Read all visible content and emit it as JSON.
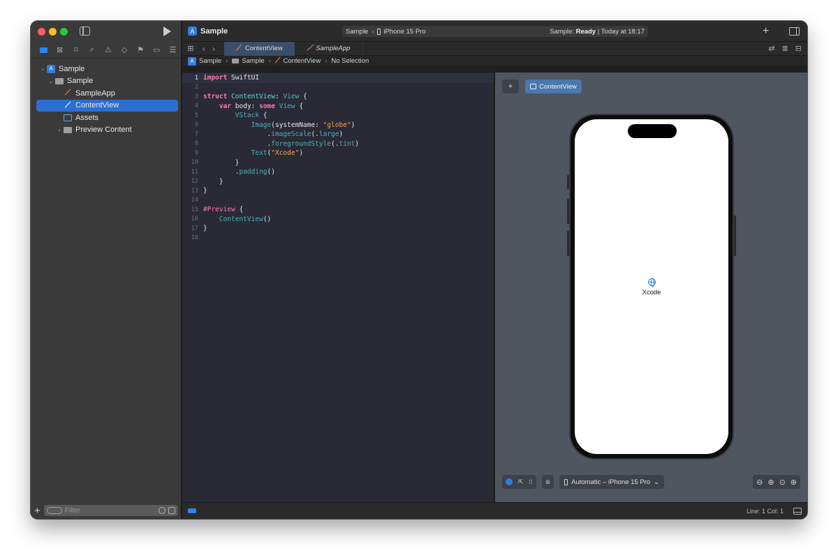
{
  "window": {
    "title": "Sample"
  },
  "toolbar": {
    "scheme_target": "Sample",
    "scheme_device": "iPhone 15 Pro",
    "status_prefix": "Sample:",
    "status_state": "Ready",
    "status_time": "| Today at 18:17"
  },
  "navigator": {
    "tree": [
      {
        "label": "Sample",
        "kind": "project",
        "depth": 0,
        "expanded": true
      },
      {
        "label": "Sample",
        "kind": "folder",
        "depth": 1,
        "expanded": true
      },
      {
        "label": "SampleApp",
        "kind": "swift",
        "depth": 2
      },
      {
        "label": "ContentView",
        "kind": "swift",
        "depth": 2,
        "selected": true
      },
      {
        "label": "Assets",
        "kind": "assets",
        "depth": 2
      },
      {
        "label": "Preview Content",
        "kind": "folder",
        "depth": 2,
        "expanded": false
      }
    ],
    "filter_placeholder": "Filter"
  },
  "tabs": [
    {
      "label": "ContentView",
      "active": true
    },
    {
      "label": "SampleApp",
      "active": false
    }
  ],
  "jumpbar": {
    "project": "Sample",
    "group": "Sample",
    "file": "ContentView",
    "symbol": "No Selection"
  },
  "editor": {
    "lines": [
      {
        "n": "1",
        "html": "<span class=\"kw\">import</span> SwiftUI"
      },
      {
        "n": "2",
        "html": ""
      },
      {
        "n": "3",
        "html": "<span class=\"kw\">struct</span> <span class=\"fn\">ContentView</span>: <span class=\"ty\">View</span> {"
      },
      {
        "n": "4",
        "html": "    <span class=\"kw\">var</span> body: <span class=\"kw\">some</span> <span class=\"ty\">View</span> {"
      },
      {
        "n": "5",
        "html": "        <span class=\"ty\">VStack</span> {"
      },
      {
        "n": "6",
        "html": "            <span class=\"ty\">Image</span>(systemName: <span class=\"str\">\"globe\"</span>)"
      },
      {
        "n": "7",
        "html": "                .<span class=\"ty\">imageScale</span>(.<span class=\"ty\">large</span>)"
      },
      {
        "n": "8",
        "html": "                .<span class=\"ty\">foregroundStyle</span>(.<span class=\"ty\">tint</span>)"
      },
      {
        "n": "9",
        "html": "            <span class=\"ty\">Text</span>(<span class=\"str\">\"Xcode\"</span>)"
      },
      {
        "n": "10",
        "html": "        }"
      },
      {
        "n": "11",
        "html": "        .<span class=\"ty\">padding</span>()"
      },
      {
        "n": "12",
        "html": "    }"
      },
      {
        "n": "13",
        "html": "}"
      },
      {
        "n": "14",
        "html": ""
      },
      {
        "n": "15",
        "html": "<span class=\"hash\">#Preview</span> {"
      },
      {
        "n": "16",
        "html": "    <span class=\"ty\">ContentView</span>()"
      },
      {
        "n": "17",
        "html": "}"
      },
      {
        "n": "18",
        "html": ""
      }
    ],
    "current_line": "1"
  },
  "preview": {
    "view_button": "ContentView",
    "screen_text": "Xcode",
    "device_menu": "Automatic – iPhone 15 Pro"
  },
  "statusbar": {
    "line_col": "Line: 1  Col: 1"
  },
  "colors": {
    "accent": "#2c6fd1",
    "editor_bg": "#292a36",
    "preview_bg": "#4f5660"
  }
}
